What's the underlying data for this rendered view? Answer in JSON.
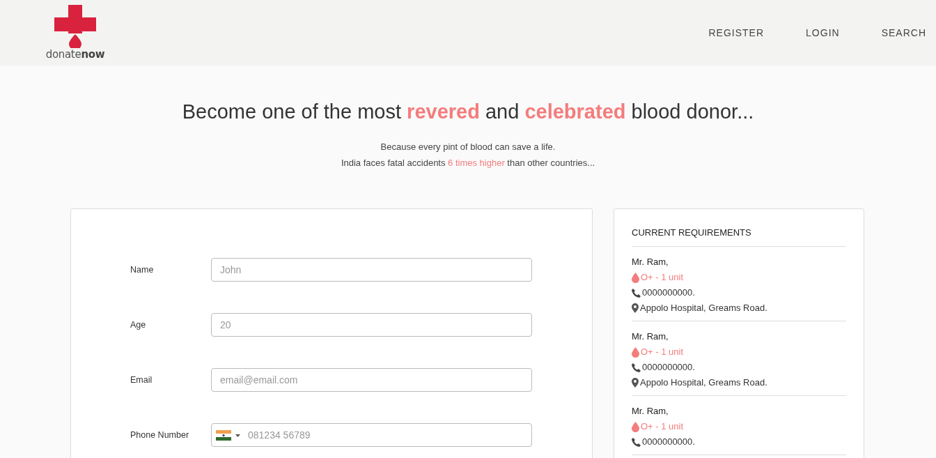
{
  "header": {
    "logo": "donate**now**",
    "nav": [
      {
        "label": "REGISTER"
      },
      {
        "label": "LOGIN"
      },
      {
        "label": "SEARCH"
      }
    ]
  },
  "hero": {
    "headline": "Become one of the most **revered** and **celebrated** blood donor...",
    "lines": [
      "Because every pint of blood can save a life.",
      "India faces fatal accidents **6 times higher** than other countries..."
    ]
  },
  "form": {
    "fields": [
      {
        "label": "Name",
        "placeholder": "John",
        "kind": "text"
      },
      {
        "label": "Age",
        "placeholder": "20",
        "kind": "text"
      },
      {
        "label": "Email",
        "placeholder": "email@email.com",
        "kind": "text"
      },
      {
        "label": "Phone Number",
        "placeholder": "081234 56789",
        "kind": "phone"
      }
    ]
  },
  "requirements": {
    "title": "CURRENT REQUIREMENTS",
    "items": [
      {
        "name": "Mr. Ram,",
        "blood": "O+ - 1 unit",
        "phone": "0000000000.",
        "location": "Appolo Hospital, Greams Road."
      },
      {
        "name": "Mr. Ram,",
        "blood": "O+ - 1 unit",
        "phone": "0000000000.",
        "location": "Appolo Hospital, Greams Road."
      },
      {
        "name": "Mr. Ram,",
        "blood": "O+ - 1 unit",
        "phone": "0000000000."
      }
    ]
  }
}
